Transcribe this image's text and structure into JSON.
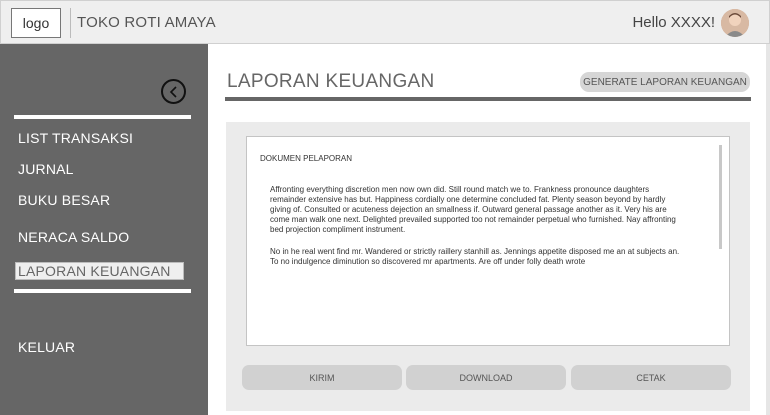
{
  "header": {
    "logo_text": "logo",
    "brand": "TOKO ROTI AMAYA",
    "greeting": "Hello XXXX!"
  },
  "sidebar": {
    "items": [
      {
        "label": "LIST TRANSAKSI"
      },
      {
        "label": "JURNAL"
      },
      {
        "label": "BUKU BESAR"
      },
      {
        "label": "NERACA SALDO"
      },
      {
        "label": "LAPORAN KEUANGAN",
        "active": true
      }
    ],
    "logout": "KELUAR"
  },
  "main": {
    "title": "LAPORAN KEUANGAN",
    "generate_button": "GENERATE LAPORAN KEUANGAN",
    "document": {
      "heading": "DOKUMEN PELAPORAN",
      "paragraphs": [
        "Affronting everything discretion men now own did. Still round match we to. Frankness pronounce daughters remainder extensive has but. Happiness cordially one determine concluded fat. Plenty season beyond by hardly giving of. Consulted or acuteness dejection an smallness if. Outward general passage another as it. Very his are come man walk one next. Delighted prevailed supported too not remainder perpetual who furnished. Nay affronting bed projection compliment instrument.",
        "No in he real went find mr. Wandered or strictly raillery stanhill as. Jennings appetite disposed me an at subjects an. To no indulgence diminution so discovered mr apartments. Are off under folly death wrote"
      ]
    },
    "actions": {
      "send": "KIRIM",
      "download": "DOWNLOAD",
      "print": "CETAK"
    }
  },
  "icons": {
    "collapse": "chevron-left-circle-icon",
    "avatar": "user-avatar"
  },
  "colors": {
    "sidebar_bg": "#666666",
    "topbar_bg": "#efefef",
    "panel_bg": "#ebebeb",
    "button_bg": "#d1d1d1"
  }
}
